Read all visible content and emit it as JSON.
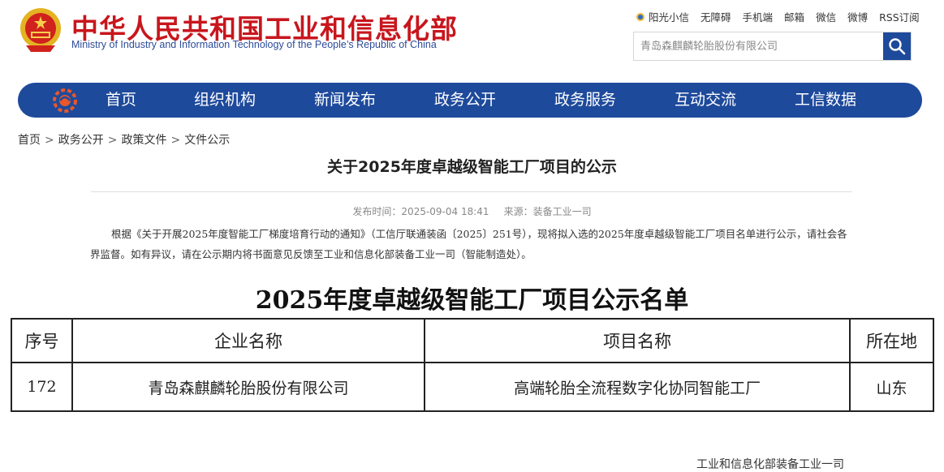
{
  "header": {
    "title": "中华人民共和国工业和信息化部",
    "subtitle": "Ministry of Industry and Information Technology of the People’s Republic of China",
    "top_links": [
      "阳光小信",
      "无障碍",
      "手机端",
      "邮箱",
      "微信",
      "微博",
      "RSS订阅"
    ],
    "search_placeholder": "青岛森麒麟轮胎股份有限公司"
  },
  "colors": {
    "brand_red": "#c8161d",
    "nav_blue": "#1e4a9c"
  },
  "nav": [
    "首页",
    "组织机构",
    "新闻发布",
    "政务公开",
    "政务服务",
    "互动交流",
    "工信数据"
  ],
  "breadcrumb": [
    "首页",
    "政务公开",
    "政策文件",
    "文件公示"
  ],
  "article": {
    "title": "关于2025年度卓越级智能工厂项目的公示",
    "publish_time": "发布时间：2025-09-04 18:41",
    "source": "来源：装备工业一司",
    "body": "根据《关于开展2025年度智能工厂梯度培育行动的通知》（工信厅联通装函〔2025〕251号），现将拟入选的2025年度卓越级智能工厂项目名单进行公示，请社会各界监督。如有异议，请在公示期内将书面意见反馈至工业和信息化部装备工业一司（智能制造处）。",
    "list_title": "2025年度卓越级智能工厂项目公示名单",
    "table": {
      "headers": [
        "序号",
        "企业名称",
        "项目名称",
        "所在地"
      ],
      "rows": [
        [
          "172",
          "青岛森麒麟轮胎股份有限公司",
          "高端轮胎全流程数字化协同智能工厂",
          "山东"
        ]
      ]
    },
    "signature": "工业和信息化部装备工业一司"
  }
}
